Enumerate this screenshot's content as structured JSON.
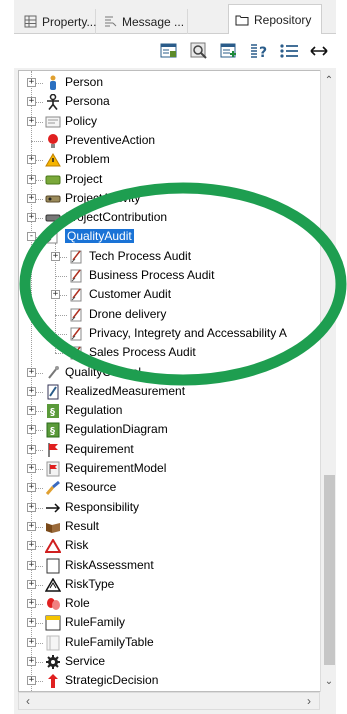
{
  "tabs": [
    {
      "label": "Property...",
      "icon": "property-icon",
      "active": false
    },
    {
      "label": "Message ...",
      "icon": "message-icon",
      "active": false
    },
    {
      "label": "Repository",
      "icon": "folder-icon",
      "active": true
    }
  ],
  "toolbar": {
    "buttons": [
      "table-view-icon",
      "search-tree-icon",
      "add-element-icon",
      "help-query-icon",
      "list-icon",
      "expand-width-icon"
    ]
  },
  "tree": {
    "selected": "QualityAudit",
    "items": [
      {
        "label": "Person",
        "icon": "person-icon",
        "level": 0,
        "expander": "+"
      },
      {
        "label": "Persona",
        "icon": "persona-icon",
        "level": 0,
        "expander": "+"
      },
      {
        "label": "Policy",
        "icon": "policy-icon",
        "level": 0,
        "expander": "+"
      },
      {
        "label": "PreventiveAction",
        "icon": "preventive-action-icon",
        "level": 0,
        "expander": ""
      },
      {
        "label": "Problem",
        "icon": "problem-icon",
        "level": 0,
        "expander": "+"
      },
      {
        "label": "Project",
        "icon": "project-icon",
        "level": 0,
        "expander": "+"
      },
      {
        "label": "ProjectActivity",
        "icon": "project-activity-icon",
        "level": 0,
        "expander": "+"
      },
      {
        "label": "ProjectContribution",
        "icon": "project-contribution-icon",
        "level": 0,
        "expander": "+"
      },
      {
        "label": "QualityAudit",
        "icon": "audit-icon",
        "level": 0,
        "expander": "-",
        "selected": true
      },
      {
        "label": "Tech Process Audit",
        "icon": "audit-icon",
        "level": 1,
        "expander": "+"
      },
      {
        "label": "Business Process Audit",
        "icon": "audit-icon",
        "level": 1,
        "expander": ""
      },
      {
        "label": "Customer Audit",
        "icon": "audit-icon",
        "level": 1,
        "expander": "+"
      },
      {
        "label": "Drone delivery",
        "icon": "audit-icon",
        "level": 1,
        "expander": ""
      },
      {
        "label": "Privacy, Integrety and Accessability A",
        "icon": "audit-icon",
        "level": 1,
        "expander": ""
      },
      {
        "label": "Sales Process Audit",
        "icon": "audit-icon",
        "level": 1,
        "expander": ""
      },
      {
        "label": "QualityControl",
        "icon": "quality-control-icon",
        "level": 0,
        "expander": "+"
      },
      {
        "label": "RealizedMeasurement",
        "icon": "measurement-icon",
        "level": 0,
        "expander": "+"
      },
      {
        "label": "Regulation",
        "icon": "regulation-icon",
        "level": 0,
        "expander": "+"
      },
      {
        "label": "RegulationDiagram",
        "icon": "regulation-diagram-icon",
        "level": 0,
        "expander": "+"
      },
      {
        "label": "Requirement",
        "icon": "requirement-flag-icon",
        "level": 0,
        "expander": "+"
      },
      {
        "label": "RequirementModel",
        "icon": "requirement-model-icon",
        "level": 0,
        "expander": "+"
      },
      {
        "label": "Resource",
        "icon": "resource-icon",
        "level": 0,
        "expander": "+"
      },
      {
        "label": "Responsibility",
        "icon": "arrow-right-icon",
        "level": 0,
        "expander": "+"
      },
      {
        "label": "Result",
        "icon": "result-icon",
        "level": 0,
        "expander": "+"
      },
      {
        "label": "Risk",
        "icon": "risk-triangle-icon",
        "level": 0,
        "expander": "+"
      },
      {
        "label": "RiskAssessment",
        "icon": "risk-assessment-icon",
        "level": 0,
        "expander": "+"
      },
      {
        "label": "RiskType",
        "icon": "risk-type-icon",
        "level": 0,
        "expander": "+"
      },
      {
        "label": "Role",
        "icon": "role-masks-icon",
        "level": 0,
        "expander": "+"
      },
      {
        "label": "RuleFamily",
        "icon": "rule-family-icon",
        "level": 0,
        "expander": "+"
      },
      {
        "label": "RuleFamilyTable",
        "icon": "rule-table-icon",
        "level": 0,
        "expander": "+"
      },
      {
        "label": "Service",
        "icon": "service-gear-icon",
        "level": 0,
        "expander": "+"
      },
      {
        "label": "StrategicDecision",
        "icon": "strategic-decision-icon",
        "level": 0,
        "expander": "+"
      }
    ]
  },
  "colors": {
    "selection": "#1a73d6",
    "annotation": "#1e9e50"
  }
}
